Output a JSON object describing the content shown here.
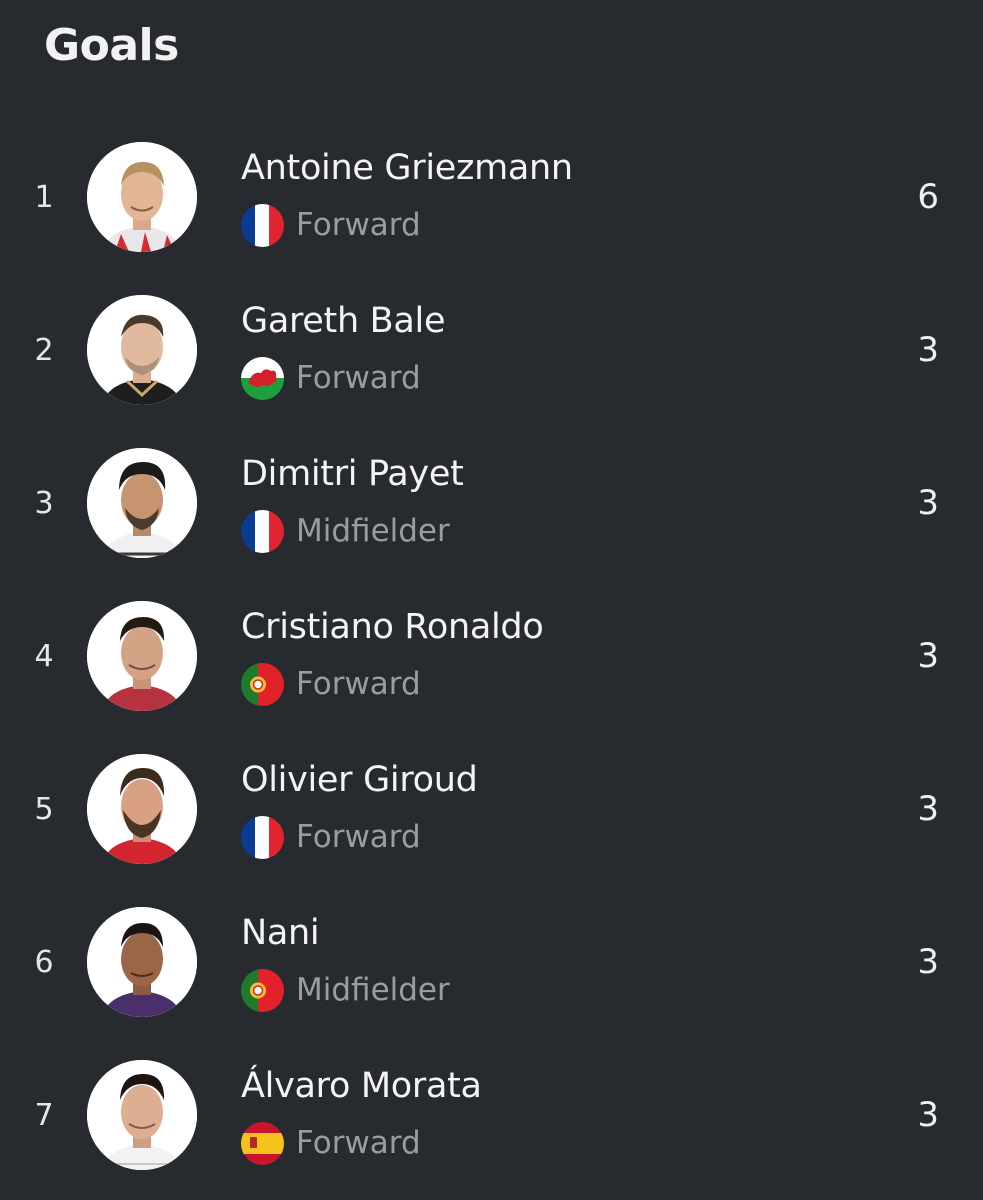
{
  "title": "Goals",
  "players": [
    {
      "rank": "1",
      "name": "Antoine Griezmann",
      "position": "Forward",
      "goals": "6",
      "flag": "france",
      "flag_icon": "france-flag-icon"
    },
    {
      "rank": "2",
      "name": "Gareth Bale",
      "position": "Forward",
      "goals": "3",
      "flag": "wales",
      "flag_icon": "wales-flag-icon"
    },
    {
      "rank": "3",
      "name": "Dimitri Payet",
      "position": "Midfielder",
      "goals": "3",
      "flag": "france",
      "flag_icon": "france-flag-icon"
    },
    {
      "rank": "4",
      "name": "Cristiano Ronaldo",
      "position": "Forward",
      "goals": "3",
      "flag": "portugal",
      "flag_icon": "portugal-flag-icon"
    },
    {
      "rank": "5",
      "name": "Olivier Giroud",
      "position": "Forward",
      "goals": "3",
      "flag": "france",
      "flag_icon": "france-flag-icon"
    },
    {
      "rank": "6",
      "name": "Nani",
      "position": "Midfielder",
      "goals": "3",
      "flag": "portugal",
      "flag_icon": "portugal-flag-icon"
    },
    {
      "rank": "7",
      "name": "Álvaro Morata",
      "position": "Forward",
      "goals": "3",
      "flag": "spain",
      "flag_icon": "spain-flag-icon"
    }
  ],
  "colors": {
    "background": "#272a2f",
    "text_primary": "#f4f4f4",
    "text_secondary": "#9a9ca0"
  }
}
